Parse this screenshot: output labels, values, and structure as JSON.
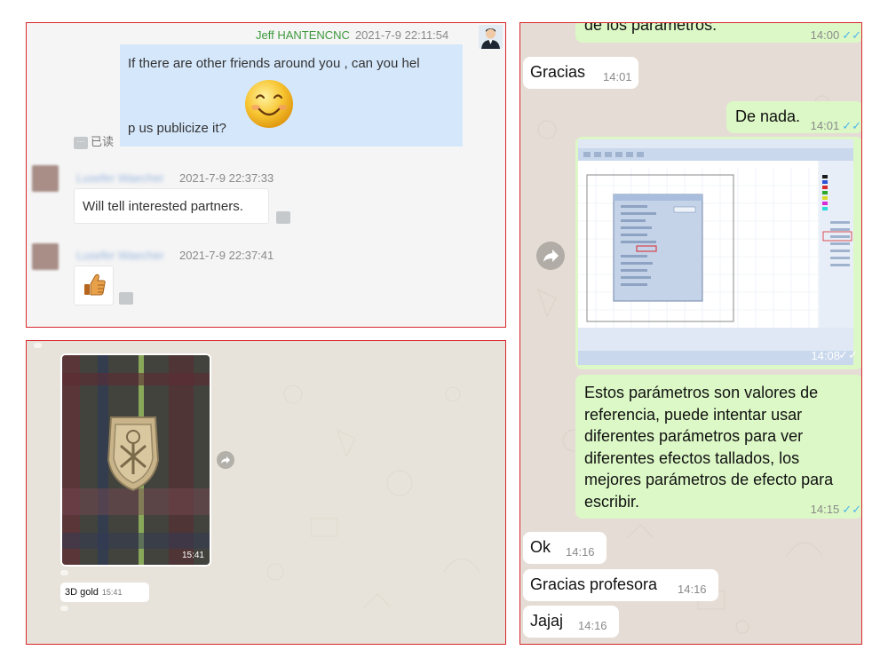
{
  "wechat": {
    "outgoing": {
      "sender": "Jeff HANTENCNC",
      "timestamp": "2021-7-9 22:11:54",
      "line1": "If there are other friends around you , can you hel",
      "line2": "p us publicize it?",
      "read_status": "已读",
      "emoji": "smiley-face-icon"
    },
    "incoming": [
      {
        "sender": "Lusefer Waecher",
        "timestamp": "2021-7-9 22:37:33",
        "text": "Will tell interested partners."
      },
      {
        "sender": "Lusefer Waecher",
        "timestamp": "2021-7-9 22:37:41",
        "sticker": "thumbs-up-icon"
      }
    ]
  },
  "photo_chat": {
    "photo_time": "15:41",
    "caption_text": "3D gold",
    "caption_time": "15:41"
  },
  "whatsapp": {
    "messages": [
      {
        "dir": "out",
        "text": "de los parametros.",
        "time": "14:00",
        "status": "read"
      },
      {
        "dir": "in",
        "text": "Gracias",
        "time": "14:01"
      },
      {
        "dir": "out",
        "text": "De nada.",
        "time": "14:01",
        "status": "read"
      },
      {
        "dir": "out",
        "type": "image",
        "time": "14:08",
        "status": "read"
      },
      {
        "dir": "out",
        "text": "Estos parámetros son valores de referencia, puede intentar usar diferentes parámetros para ver diferentes efectos tallados, los mejores parámetros de efecto para escribir.",
        "time": "14:15",
        "status": "read"
      },
      {
        "dir": "in",
        "text": "Ok",
        "time": "14:16"
      },
      {
        "dir": "in",
        "text": "Gracias profesora",
        "time": "14:16"
      },
      {
        "dir": "in",
        "text": "Jajaj",
        "time": "14:16"
      }
    ],
    "lines_long": [
      "Estos parámetros son valores de",
      "referencia, puede intentar usar",
      "diferentes parámetros para ver",
      "diferentes efectos tallados, los",
      "mejores parámetros de efecto para",
      "escribir."
    ],
    "check_mark": "✓✓"
  },
  "colors": {
    "border": "#d9262c",
    "wechat_bubble": "#d5e7fb",
    "whatsapp_out": "#dcf8c6",
    "whatsapp_bg": "#e5ddd5",
    "sender_green": "#3c9a3c",
    "read_tick": "#4fb6ec"
  }
}
